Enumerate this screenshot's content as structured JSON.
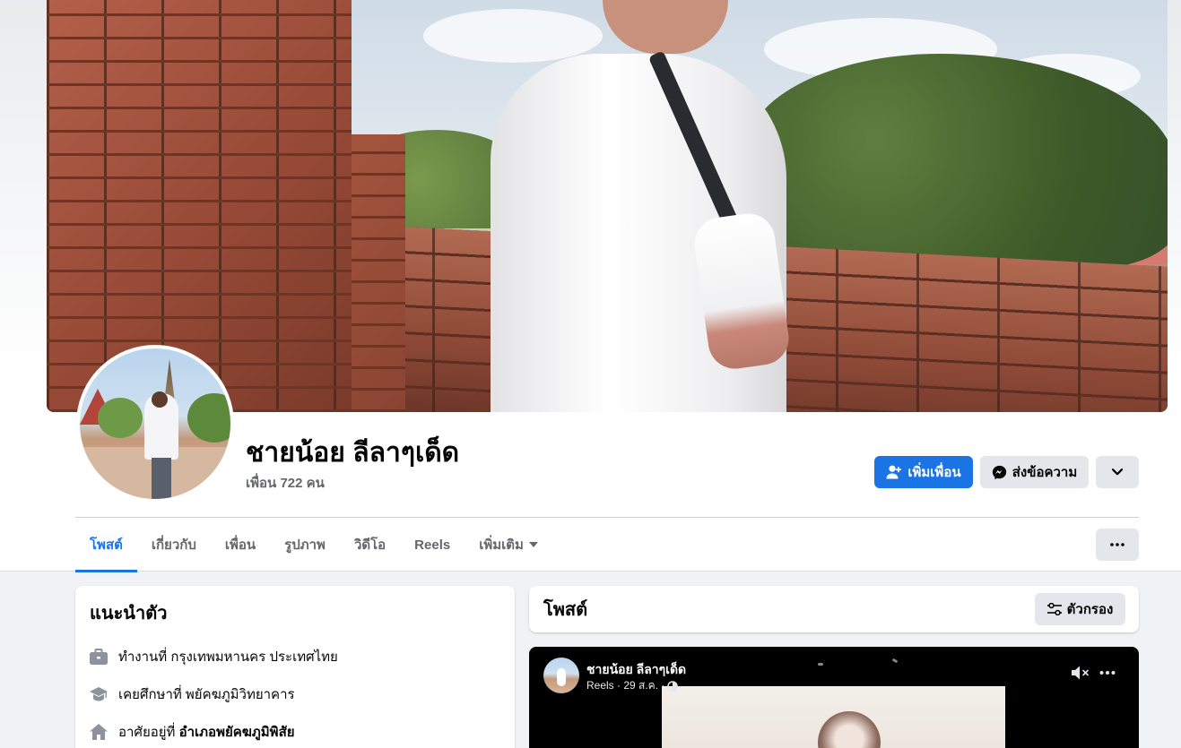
{
  "profile": {
    "name": "ชายน้อย ลีลาๆเด็ด",
    "friends": "เพื่อน 722 คน"
  },
  "actions": {
    "add_friend": "เพิ่มเพื่อน",
    "message": "ส่งข้อความ"
  },
  "tabs": [
    {
      "label": "โพสต์",
      "active": true
    },
    {
      "label": "เกี่ยวกับ"
    },
    {
      "label": "เพื่อน"
    },
    {
      "label": "รูปภาพ"
    },
    {
      "label": "วิดีโอ"
    },
    {
      "label": "Reels"
    },
    {
      "label": "เพิ่มเติม"
    }
  ],
  "intro": {
    "title": "แนะนำตัว",
    "items": [
      {
        "icon": "briefcase-icon",
        "text": "ทำงานที่ กรุงเทพมหานคร ประเทศไทย"
      },
      {
        "icon": "graduation-cap-icon",
        "text": "เคยศึกษาที่ พยัคฆภูมิวิทยาคาร"
      },
      {
        "icon": "home-icon",
        "prefix": "อาศัยอยู่ที่ ",
        "bold": "อำเภอพยัคฆภูมิพิสัย"
      }
    ]
  },
  "posts": {
    "title": "โพสต์",
    "filter_label": "ตัวกรอง"
  },
  "reel_post": {
    "author": "ชายน้อย ลีลาๆเด็ด",
    "meta": "Reels · 29 ส.ค. ·"
  },
  "colors": {
    "primary": "#1b74e4",
    "secondary_button": "#e4e6eb",
    "muted_text": "#65676b",
    "background": "#f0f2f5"
  }
}
